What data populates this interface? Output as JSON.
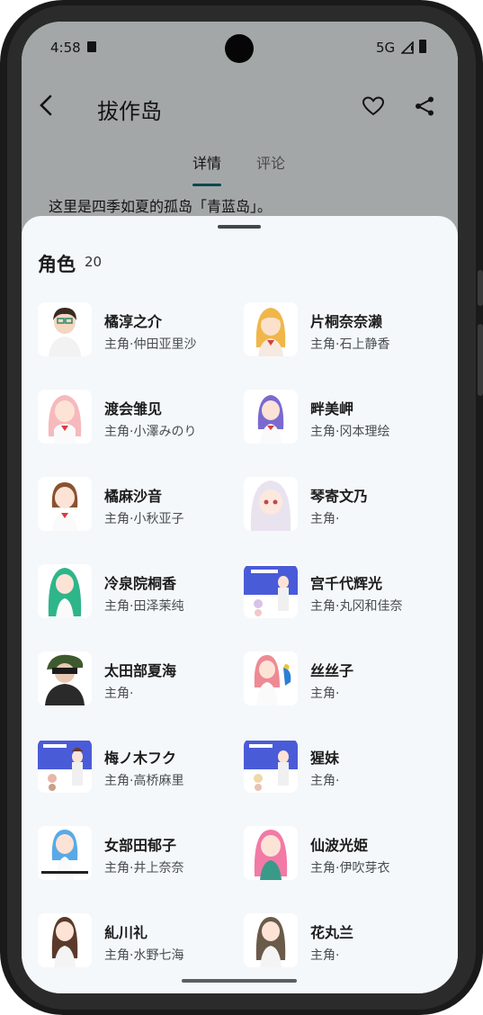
{
  "status_bar": {
    "time": "4:58",
    "network": "5G"
  },
  "app_bar": {
    "title": "拔作岛",
    "back_icon": "back-arrow-icon",
    "favorite_icon": "heart-icon",
    "share_icon": "share-icon"
  },
  "tabs": [
    {
      "label": "详情",
      "active": true
    },
    {
      "label": "评论",
      "active": false
    }
  ],
  "description": "这里是四季如夏的孤岛「青蓝岛」。",
  "sheet": {
    "title": "角色",
    "count": "20",
    "characters": [
      {
        "name": "橘淳之介",
        "role": "主角·仲田亚里沙"
      },
      {
        "name": "片桐奈奈濑",
        "role": "主角·石上静香"
      },
      {
        "name": "渡会雏见",
        "role": "主角·小澤みのり"
      },
      {
        "name": "畔美岬",
        "role": "主角·冈本理绘"
      },
      {
        "name": "橘麻沙音",
        "role": "主角·小秋亚子"
      },
      {
        "name": "琴寄文乃",
        "role": "主角·"
      },
      {
        "name": "冷泉院桐香",
        "role": "主角·田泽茉纯"
      },
      {
        "name": "宫千代辉光",
        "role": "主角·丸冈和佳奈"
      },
      {
        "name": "太田部夏海",
        "role": "主角·"
      },
      {
        "name": "丝丝子",
        "role": "主角·"
      },
      {
        "name": "梅ノ木フク",
        "role": "主角·高桥麻里"
      },
      {
        "name": "猩妹",
        "role": "主角·"
      },
      {
        "name": "女部田郁子",
        "role": "主角·井上奈奈"
      },
      {
        "name": "仙波光姫",
        "role": "主角·伊吹芽衣"
      },
      {
        "name": "糺川礼",
        "role": "主角·水野七海"
      },
      {
        "name": "花丸兰",
        "role": "主角·"
      }
    ]
  },
  "colors": {
    "accent": "#0f6a77",
    "sheet_bg": "#f4f8fa"
  }
}
